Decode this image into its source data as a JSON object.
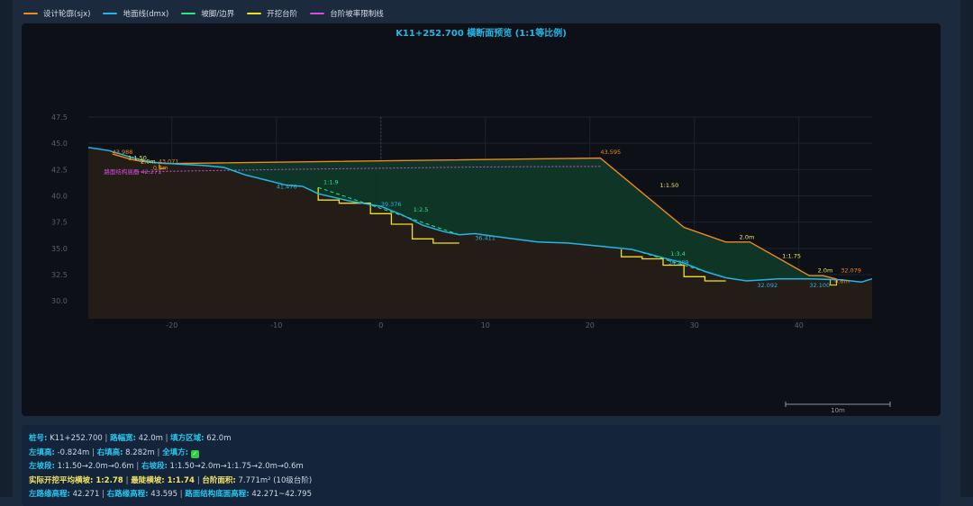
{
  "legend": [
    {
      "label": "设计轮廓(sjx)",
      "color": "#f0891e"
    },
    {
      "label": "地面线(dmx)",
      "color": "#1fb8e8"
    },
    {
      "label": "坡脚/边界",
      "color": "#2ee58a"
    },
    {
      "label": "开挖台阶",
      "color": "#f2e11a"
    },
    {
      "label": "台阶坡率限制线",
      "color": "#d44fe0"
    }
  ],
  "chart_data": {
    "type": "line",
    "title": "K11+252.700 横断面预览 (1:1等比例)",
    "xlim": [
      -28,
      47
    ],
    "ylim": [
      28.3,
      47.5
    ],
    "x_ticks": [
      -20,
      -10,
      0,
      10,
      20,
      30,
      40
    ],
    "y_ticks": [
      30.0,
      32.5,
      35.0,
      37.5,
      40.0,
      42.5,
      45.0,
      47.5
    ],
    "grid": true,
    "scale_bar": "10m",
    "series": [
      {
        "key": "ground",
        "points": [
          [
            -28,
            44.6
          ],
          [
            -26,
            44.3
          ],
          [
            -24,
            43.7
          ],
          [
            -22,
            43.2
          ],
          [
            -19,
            43.0
          ],
          [
            -17,
            42.9
          ],
          [
            -15,
            42.7
          ],
          [
            -13,
            42.0
          ],
          [
            -11,
            41.5
          ],
          [
            -9,
            41.0
          ],
          [
            -7.5,
            40.9
          ],
          [
            -6,
            40.2
          ],
          [
            -3,
            39.5
          ],
          [
            0,
            39.0
          ],
          [
            2,
            38.2
          ],
          [
            4,
            37.2
          ],
          [
            6,
            36.6
          ],
          [
            7.5,
            36.3
          ],
          [
            9,
            36.4
          ],
          [
            12,
            36.0
          ],
          [
            15,
            35.6
          ],
          [
            18,
            35.5
          ],
          [
            21,
            35.2
          ],
          [
            24,
            34.9
          ],
          [
            27,
            34.1
          ],
          [
            29,
            33.6
          ],
          [
            31,
            32.8
          ],
          [
            33,
            32.2
          ],
          [
            35,
            31.9
          ],
          [
            38,
            32.1
          ],
          [
            41,
            32.1
          ],
          [
            44,
            32.0
          ],
          [
            46,
            31.8
          ],
          [
            47,
            32.1
          ]
        ]
      },
      {
        "key": "design",
        "points": [
          [
            -25.7,
            43.988
          ],
          [
            -24,
            43.5
          ],
          [
            -23,
            43.3
          ],
          [
            -21,
            43.1
          ],
          [
            -20.6,
            43.071
          ],
          [
            21,
            43.595
          ],
          [
            29,
            37.0
          ],
          [
            33,
            35.6
          ],
          [
            35.3,
            35.6
          ],
          [
            41,
            32.4
          ],
          [
            42.3,
            32.4
          ],
          [
            43.6,
            32.079
          ]
        ]
      },
      {
        "key": "limit",
        "points": [
          [
            -24,
            42.27
          ],
          [
            -10,
            42.5
          ],
          [
            10,
            42.75
          ],
          [
            21,
            42.8
          ]
        ]
      },
      {
        "key": "bench",
        "points": [
          [
            -6,
            40.8
          ],
          [
            -6,
            39.6
          ],
          [
            -4,
            39.6
          ],
          [
            -4,
            39.3
          ],
          [
            -1,
            39.3
          ],
          [
            -1,
            38.3
          ],
          [
            1,
            38.3
          ],
          [
            1,
            37.3
          ],
          [
            3,
            37.3
          ],
          [
            3,
            35.9
          ],
          [
            5,
            35.9
          ],
          [
            5,
            35.5
          ],
          [
            7.5,
            35.5
          ]
        ]
      },
      {
        "key": "bench2",
        "points": [
          [
            23,
            34.9
          ],
          [
            23,
            34.2
          ],
          [
            25,
            34.2
          ],
          [
            25,
            34.0
          ],
          [
            27,
            34.0
          ],
          [
            27,
            33.4
          ],
          [
            29,
            33.4
          ],
          [
            29,
            32.3
          ],
          [
            31,
            32.3
          ],
          [
            31,
            31.9
          ],
          [
            33,
            31.9
          ]
        ]
      },
      {
        "key": "toe",
        "points": [
          [
            -6,
            40.8
          ],
          [
            7.5,
            36.3
          ]
        ]
      },
      {
        "key": "toe2",
        "points": [
          [
            25,
            34.6
          ],
          [
            33,
            32.2
          ]
        ]
      }
    ],
    "fill_excavation": "#0e3a27",
    "fill_ground": "#241c17",
    "annotations": [
      {
        "text": "43.988",
        "x": -25.7,
        "y": 43.988,
        "color": "#f0891e"
      },
      {
        "text": "1:1.50",
        "x": -24.2,
        "y": 43.45,
        "color": "#f5e663"
      },
      {
        "text": "2.0m",
        "x": -23.0,
        "y": 43.1,
        "color": "#f5e663"
      },
      {
        "text": "43.071",
        "x": -21.3,
        "y": 43.071,
        "color": "#f0891e"
      },
      {
        "text": "0.6m",
        "x": -21.8,
        "y": 42.5,
        "color": "#f0891e"
      },
      {
        "text": "路面结构底面 42.271",
        "x": -26.5,
        "y": 42.1,
        "color": "#d44fe0"
      },
      {
        "text": "41.476",
        "x": -10,
        "y": 40.7,
        "color": "#1fb8e8"
      },
      {
        "text": "1:1.9",
        "x": -5.5,
        "y": 41.1,
        "color": "#2ee58a"
      },
      {
        "text": "39.376",
        "x": 0,
        "y": 39.0,
        "color": "#1fb8e8"
      },
      {
        "text": "1:2.5",
        "x": 3.1,
        "y": 38.5,
        "color": "#2ee58a"
      },
      {
        "text": "36.411",
        "x": 9,
        "y": 35.8,
        "color": "#1fb8e8"
      },
      {
        "text": "43.595",
        "x": 21,
        "y": 44.0,
        "color": "#f0891e"
      },
      {
        "text": "1:1.50",
        "x": 26.7,
        "y": 40.8,
        "color": "#f5e663"
      },
      {
        "text": "2.0m",
        "x": 34.3,
        "y": 35.9,
        "color": "#f5e663"
      },
      {
        "text": "1:1.75",
        "x": 38.4,
        "y": 34.1,
        "color": "#f5e663"
      },
      {
        "text": "1:3.4",
        "x": 27.7,
        "y": 34.3,
        "color": "#2ee58a"
      },
      {
        "text": "34.389",
        "x": 27.5,
        "y": 33.5,
        "color": "#1fb8e8"
      },
      {
        "text": "2.0m",
        "x": 41.8,
        "y": 32.7,
        "color": "#f5e663"
      },
      {
        "text": "32.079",
        "x": 44.0,
        "y": 32.7,
        "color": "#f0891e"
      },
      {
        "text": "0.6m",
        "x": 43.4,
        "y": 31.7,
        "color": "#f0891e"
      },
      {
        "text": "32.092",
        "x": 36,
        "y": 31.3,
        "color": "#1fb8e8"
      },
      {
        "text": "32.100",
        "x": 41,
        "y": 31.3,
        "color": "#1fb8e8"
      }
    ]
  },
  "info": {
    "l1": [
      {
        "k": "桩号:",
        "v": " K11+252.700 "
      },
      {
        "k": "路幅宽:",
        "v": " 42.0m "
      },
      {
        "k": "填方区域:",
        "v": " 62.0m"
      }
    ],
    "l2": [
      {
        "k": "左填高:",
        "v": " -0.824m "
      },
      {
        "k": "右填高:",
        "v": " 8.282m "
      },
      {
        "k": "全填方:",
        "v": " "
      }
    ],
    "l2_check": "✓",
    "l3": [
      {
        "k": "左坡段:",
        "v": " 1:1.50→2.0m→0.6m "
      },
      {
        "k": "右坡段:",
        "v": " 1:1.50→2.0m→1:1.75→2.0m→0.6m"
      }
    ],
    "l4": [
      {
        "k": "实际开挖平均横坡:",
        "v": " 1:2.78 "
      },
      {
        "k": "最陡横坡:",
        "v": " 1:1.74 "
      },
      {
        "k": "台阶面积:",
        "v": " 7.771m² (10级台阶)"
      }
    ],
    "l5": [
      {
        "k": "左路缘高程:",
        "v": " 42.271 "
      },
      {
        "k": "右路缘高程:",
        "v": " 43.595 "
      },
      {
        "k": "路面结构底面高程:",
        "v": " 42.271~42.795"
      }
    ]
  }
}
